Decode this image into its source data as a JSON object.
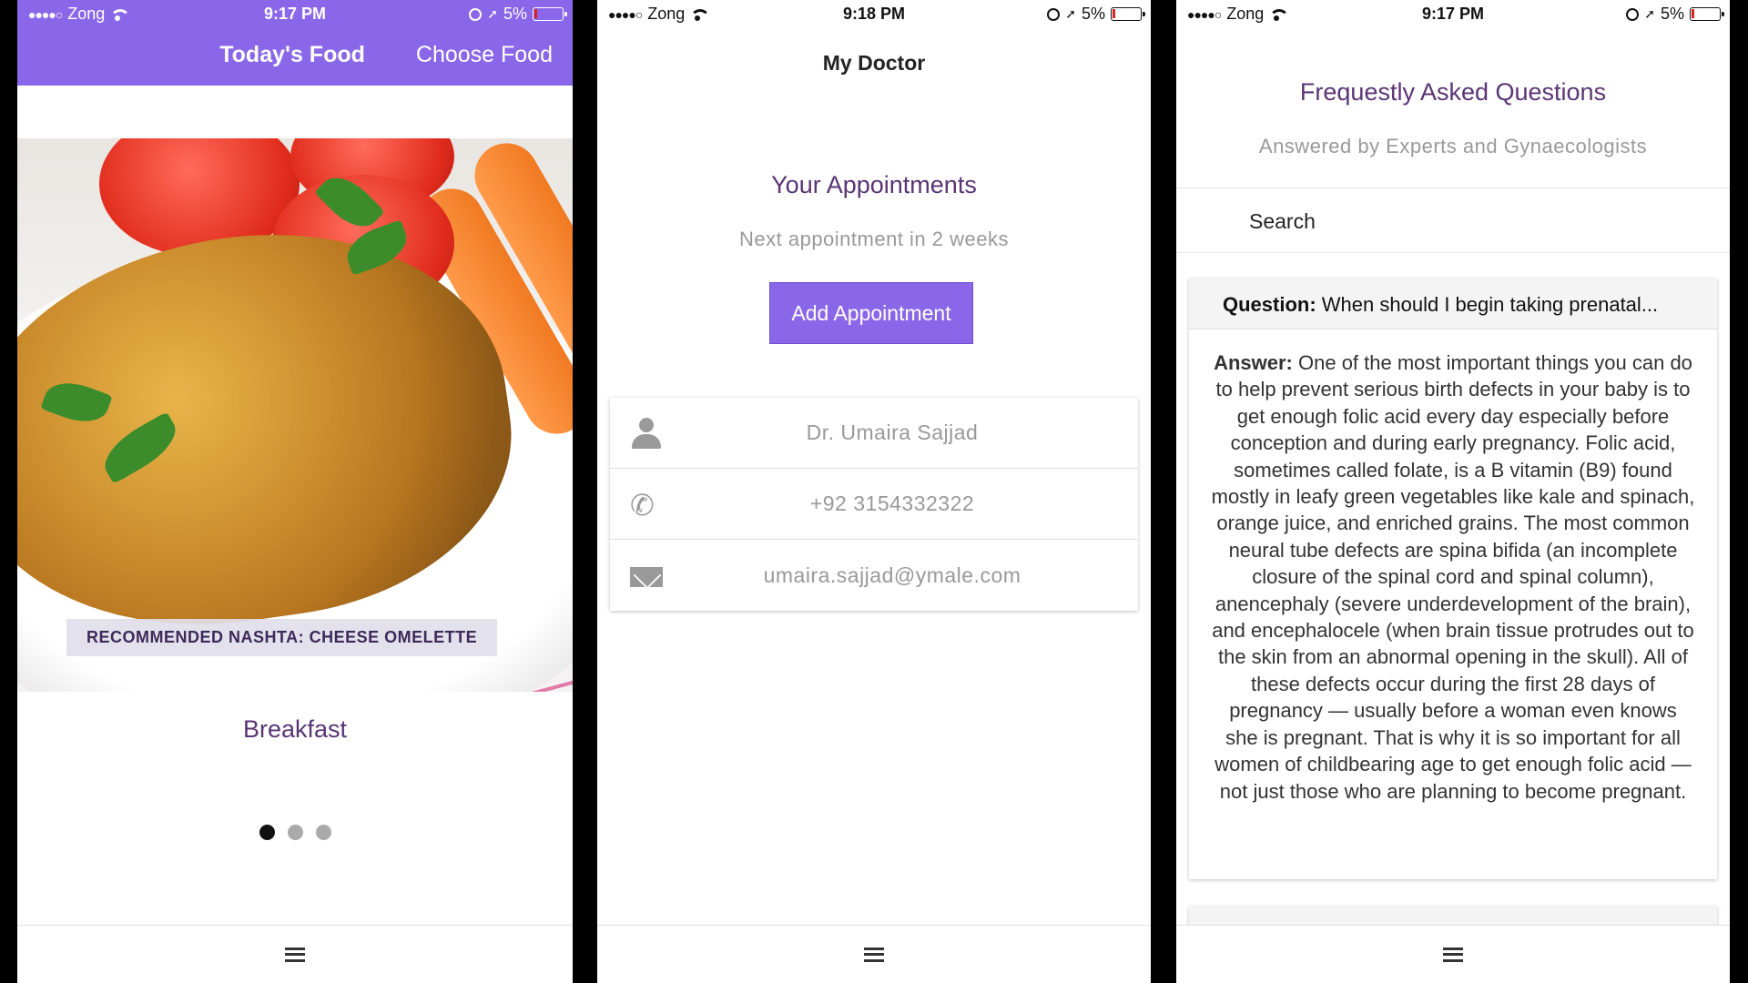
{
  "screens": [
    {
      "status": {
        "carrier": "Zong",
        "time": "9:17 PM",
        "battery": "5%"
      },
      "tabs": [
        {
          "label": "Today's Food"
        },
        {
          "label": "Choose Food"
        }
      ],
      "food_caption": "RECOMMENDED NASHTA: CHEESE OMELETTE",
      "meal_title": "Breakfast",
      "pager": {
        "count": 3,
        "active": 1
      }
    },
    {
      "status": {
        "carrier": "Zong",
        "time": "9:18 PM",
        "battery": "5%"
      },
      "title": "My Doctor",
      "section_title": "Your Appointments",
      "next_appointment": "Next appointment in 2 weeks",
      "add_button": "Add Appointment",
      "contact": {
        "name": "Dr. Umaira Sajjad",
        "phone": "+92 3154332322",
        "email": "umaira.sajjad@ymale.com"
      },
      "icons": {
        "name": "user-icon",
        "phone": "phone-icon",
        "email": "envelope-icon"
      }
    },
    {
      "status": {
        "carrier": "Zong",
        "time": "9:17 PM",
        "battery": "5%"
      },
      "title": "Frequestly Asked Questions",
      "subtitle": "Answered by Experts and Gynaecologists",
      "search_placeholder": "Search",
      "faq": [
        {
          "q_label": "Question:",
          "question": "When should I begin taking prenatal...",
          "a_label": "Answer:",
          "answer": "One of the most important things you can do to help prevent serious birth defects in your baby is to get enough folic acid every day especially before conception and during early pregnancy. Folic acid, sometimes called folate, is a B vitamin (B9) found mostly in leafy green vegetables like kale and spinach, orange juice, and enriched grains. The most common neural tube defects are spina bifida (an incomplete closure of the spinal cord and spinal column), anencephaly (severe underdevelopment of the brain), and encephalocele (when brain tissue protrudes out to the skin from an abnormal opening in the skull). All of these defects occur during the first 28 days of pregnancy — usually before a woman even knows she is pregnant. That is why it is so important for all women of childbearing age to get enough folic acid — not just those who are planning to become pregnant."
        }
      ]
    }
  ],
  "colors": {
    "accent": "#8a67e8",
    "title_purple": "#5a3474",
    "muted": "#999999"
  }
}
